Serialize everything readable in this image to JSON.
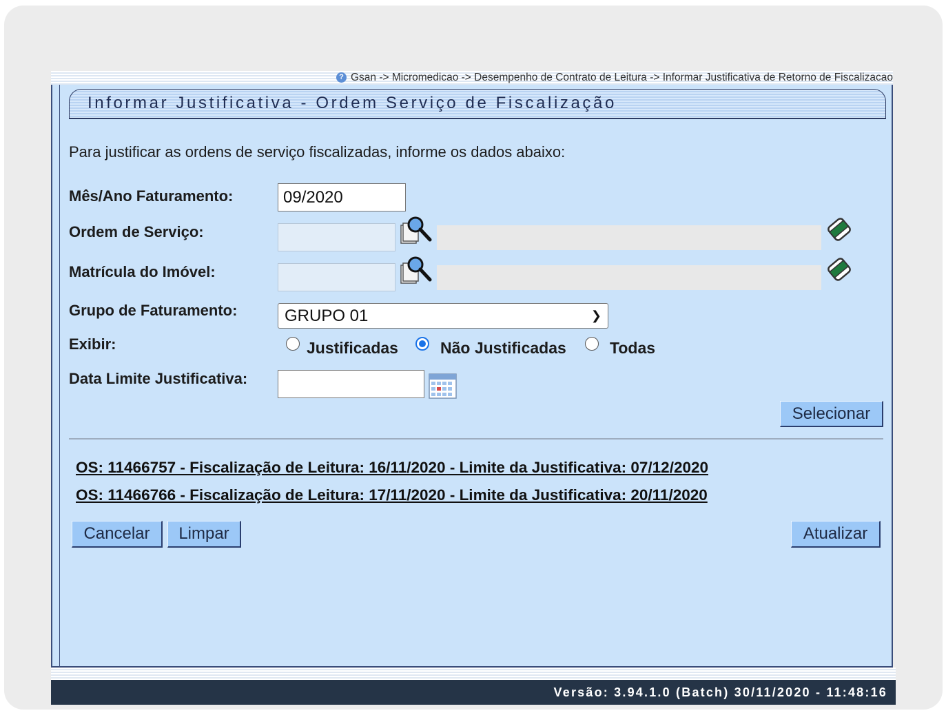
{
  "breadcrumb": {
    "text": "Gsan -> Micromedicao -> Desempenho de Contrato de Leitura -> Informar Justificativa de Retorno de Fiscalizacao",
    "icon": "help-icon"
  },
  "form": {
    "title": "Informar Justificativa - Ordem Serviço de Fiscalização",
    "instruction": "Para justificar as ordens de serviço fiscalizadas, informe os dados abaixo:",
    "mes_ano": {
      "label": "Mês/Ano Faturamento:",
      "value": "09/2020"
    },
    "ordem_servico": {
      "label": "Ordem de Serviço:",
      "value": "",
      "description": ""
    },
    "matricula": {
      "label": "Matrícula do Imóvel:",
      "value": "",
      "description": ""
    },
    "grupo": {
      "label": "Grupo de Faturamento:",
      "selected": "GRUPO 01"
    },
    "exibir": {
      "label": "Exibir:",
      "options": [
        "Justificadas",
        "Não Justificadas",
        "Todas"
      ],
      "selected": "Não Justificadas"
    },
    "data_limite": {
      "label": "Data Limite Justificativa:",
      "value": ""
    },
    "selecionar_label": "Selecionar"
  },
  "orders": [
    "OS: 11466757 - Fiscalização de Leitura: 16/11/2020 - Limite da Justificativa: 07/12/2020",
    "OS: 11466766 - Fiscalização de Leitura: 17/11/2020 - Limite da Justificativa: 20/11/2020"
  ],
  "actions": {
    "cancel": "Cancelar",
    "clear": "Limpar",
    "update": "Atualizar"
  },
  "footer": {
    "version": "Versão: 3.94.1.0 (Batch) 30/11/2020 - 11:48:16"
  },
  "colors": {
    "panel_bg": "#cbe3fa",
    "button_bg": "#9cc8f7",
    "footer_bg": "#253447",
    "radio_accent": "#1a73e8"
  }
}
